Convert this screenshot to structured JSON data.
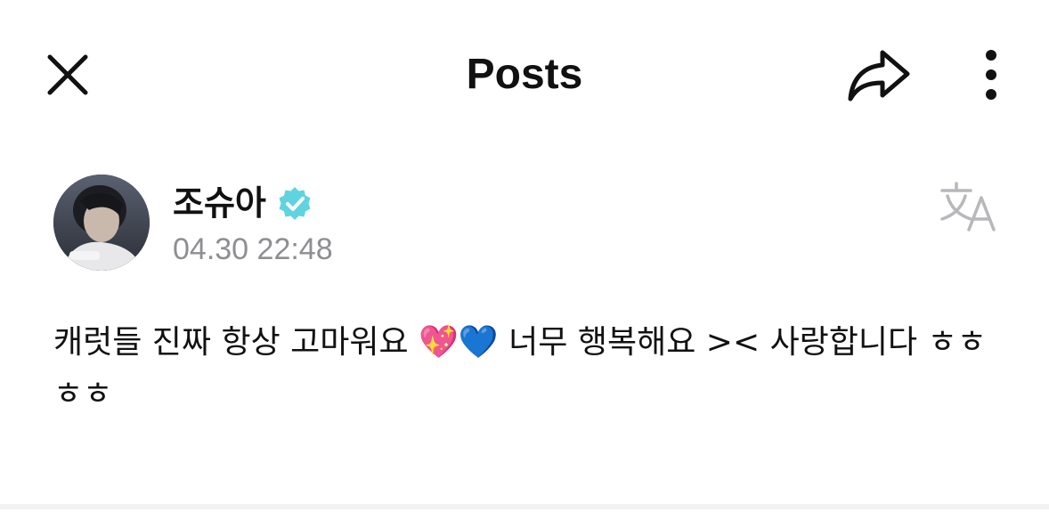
{
  "header": {
    "title": "Posts",
    "close_icon": "close-icon",
    "share_icon": "share-icon",
    "more_icon": "more-vertical-icon"
  },
  "post": {
    "author": "조슈아",
    "verified_icon": "verified-badge-icon",
    "verified_color": "#5fd4e0",
    "timestamp": "04.30 22:48",
    "translate_icon": "translate-icon",
    "body": "캐럿들 진짜 항상 고마워요 💖💙 너무 행복해요 >< 사랑합니다 ㅎㅎㅎㅎ"
  }
}
